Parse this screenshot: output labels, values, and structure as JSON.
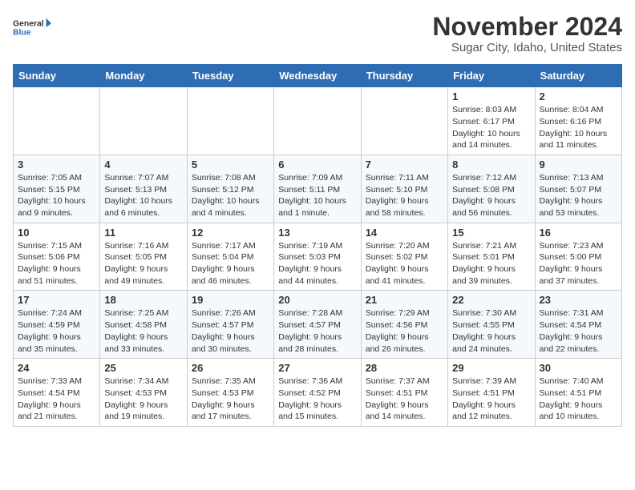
{
  "header": {
    "logo_line1": "General",
    "logo_line2": "Blue",
    "title": "November 2024",
    "subtitle": "Sugar City, Idaho, United States"
  },
  "weekdays": [
    "Sunday",
    "Monday",
    "Tuesday",
    "Wednesday",
    "Thursday",
    "Friday",
    "Saturday"
  ],
  "weeks": [
    [
      {
        "day": "",
        "info": ""
      },
      {
        "day": "",
        "info": ""
      },
      {
        "day": "",
        "info": ""
      },
      {
        "day": "",
        "info": ""
      },
      {
        "day": "",
        "info": ""
      },
      {
        "day": "1",
        "info": "Sunrise: 8:03 AM\nSunset: 6:17 PM\nDaylight: 10 hours and 14 minutes."
      },
      {
        "day": "2",
        "info": "Sunrise: 8:04 AM\nSunset: 6:16 PM\nDaylight: 10 hours and 11 minutes."
      }
    ],
    [
      {
        "day": "3",
        "info": "Sunrise: 7:05 AM\nSunset: 5:15 PM\nDaylight: 10 hours and 9 minutes."
      },
      {
        "day": "4",
        "info": "Sunrise: 7:07 AM\nSunset: 5:13 PM\nDaylight: 10 hours and 6 minutes."
      },
      {
        "day": "5",
        "info": "Sunrise: 7:08 AM\nSunset: 5:12 PM\nDaylight: 10 hours and 4 minutes."
      },
      {
        "day": "6",
        "info": "Sunrise: 7:09 AM\nSunset: 5:11 PM\nDaylight: 10 hours and 1 minute."
      },
      {
        "day": "7",
        "info": "Sunrise: 7:11 AM\nSunset: 5:10 PM\nDaylight: 9 hours and 58 minutes."
      },
      {
        "day": "8",
        "info": "Sunrise: 7:12 AM\nSunset: 5:08 PM\nDaylight: 9 hours and 56 minutes."
      },
      {
        "day": "9",
        "info": "Sunrise: 7:13 AM\nSunset: 5:07 PM\nDaylight: 9 hours and 53 minutes."
      }
    ],
    [
      {
        "day": "10",
        "info": "Sunrise: 7:15 AM\nSunset: 5:06 PM\nDaylight: 9 hours and 51 minutes."
      },
      {
        "day": "11",
        "info": "Sunrise: 7:16 AM\nSunset: 5:05 PM\nDaylight: 9 hours and 49 minutes."
      },
      {
        "day": "12",
        "info": "Sunrise: 7:17 AM\nSunset: 5:04 PM\nDaylight: 9 hours and 46 minutes."
      },
      {
        "day": "13",
        "info": "Sunrise: 7:19 AM\nSunset: 5:03 PM\nDaylight: 9 hours and 44 minutes."
      },
      {
        "day": "14",
        "info": "Sunrise: 7:20 AM\nSunset: 5:02 PM\nDaylight: 9 hours and 41 minutes."
      },
      {
        "day": "15",
        "info": "Sunrise: 7:21 AM\nSunset: 5:01 PM\nDaylight: 9 hours and 39 minutes."
      },
      {
        "day": "16",
        "info": "Sunrise: 7:23 AM\nSunset: 5:00 PM\nDaylight: 9 hours and 37 minutes."
      }
    ],
    [
      {
        "day": "17",
        "info": "Sunrise: 7:24 AM\nSunset: 4:59 PM\nDaylight: 9 hours and 35 minutes."
      },
      {
        "day": "18",
        "info": "Sunrise: 7:25 AM\nSunset: 4:58 PM\nDaylight: 9 hours and 33 minutes."
      },
      {
        "day": "19",
        "info": "Sunrise: 7:26 AM\nSunset: 4:57 PM\nDaylight: 9 hours and 30 minutes."
      },
      {
        "day": "20",
        "info": "Sunrise: 7:28 AM\nSunset: 4:57 PM\nDaylight: 9 hours and 28 minutes."
      },
      {
        "day": "21",
        "info": "Sunrise: 7:29 AM\nSunset: 4:56 PM\nDaylight: 9 hours and 26 minutes."
      },
      {
        "day": "22",
        "info": "Sunrise: 7:30 AM\nSunset: 4:55 PM\nDaylight: 9 hours and 24 minutes."
      },
      {
        "day": "23",
        "info": "Sunrise: 7:31 AM\nSunset: 4:54 PM\nDaylight: 9 hours and 22 minutes."
      }
    ],
    [
      {
        "day": "24",
        "info": "Sunrise: 7:33 AM\nSunset: 4:54 PM\nDaylight: 9 hours and 21 minutes."
      },
      {
        "day": "25",
        "info": "Sunrise: 7:34 AM\nSunset: 4:53 PM\nDaylight: 9 hours and 19 minutes."
      },
      {
        "day": "26",
        "info": "Sunrise: 7:35 AM\nSunset: 4:53 PM\nDaylight: 9 hours and 17 minutes."
      },
      {
        "day": "27",
        "info": "Sunrise: 7:36 AM\nSunset: 4:52 PM\nDaylight: 9 hours and 15 minutes."
      },
      {
        "day": "28",
        "info": "Sunrise: 7:37 AM\nSunset: 4:51 PM\nDaylight: 9 hours and 14 minutes."
      },
      {
        "day": "29",
        "info": "Sunrise: 7:39 AM\nSunset: 4:51 PM\nDaylight: 9 hours and 12 minutes."
      },
      {
        "day": "30",
        "info": "Sunrise: 7:40 AM\nSunset: 4:51 PM\nDaylight: 9 hours and 10 minutes."
      }
    ]
  ]
}
